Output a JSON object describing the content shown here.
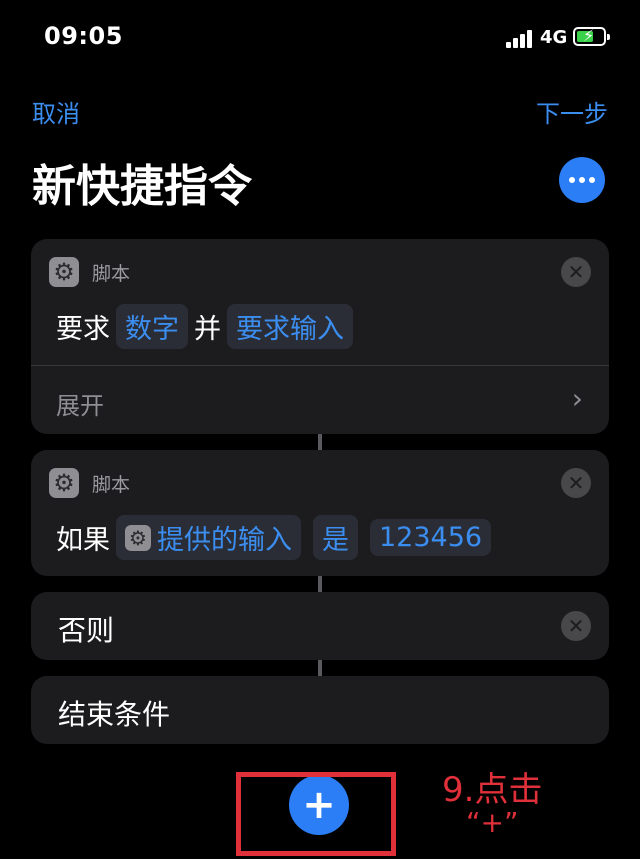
{
  "status_bar": {
    "time": "09:05",
    "network": "4G"
  },
  "nav": {
    "cancel": "取消",
    "next": "下一步"
  },
  "title": "新快捷指令",
  "cards": {
    "ask": {
      "category": "脚本",
      "verb": "要求",
      "type_token": "数字",
      "connector": "并",
      "prompt_token": "要求输入",
      "expand": "展开"
    },
    "if": {
      "category": "脚本",
      "verb": "如果",
      "input_token": "提供的输入",
      "op_token": "是",
      "value_token": "123456"
    },
    "otherwise": {
      "label": "否则"
    },
    "end": {
      "label": "结束条件"
    }
  },
  "add_button": {
    "label": "+"
  },
  "annotation": {
    "line1": "9.点击",
    "line2": "“+”",
    "color": "#e0303a"
  },
  "colors": {
    "accent": "#2b7ef6",
    "link": "#3b8ef0",
    "card": "#1c1c1e"
  }
}
